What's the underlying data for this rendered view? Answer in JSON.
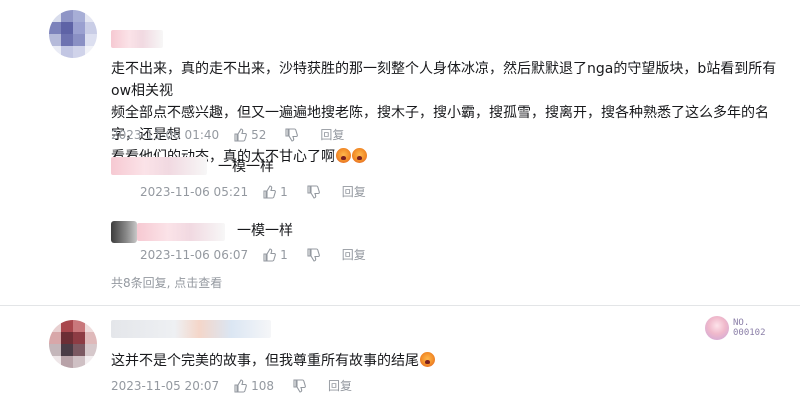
{
  "comments": [
    {
      "text_parts": [
        "走不出来，真的走不出来，沙特获胜的那一刻整个人身体冰凉，然后默默退了nga的守望版块，b站看到所有ow相关视",
        "频全部点不感兴趣，但又一遍遍地搜老陈，搜木子，搜小霸，搜孤雪，搜离开，搜各种熟悉了这么多年的名字，还是想",
        "看看他们的动态，真的太不甘心了啊"
      ],
      "time": "2023-11-06 01:40",
      "likes": "52",
      "reply_label": "回复",
      "replies": [
        {
          "text": "一模一样",
          "time": "2023-11-06 05:21",
          "likes": "1",
          "reply_label": "回复"
        },
        {
          "text": "一模一样",
          "time": "2023-11-06 06:07",
          "likes": "1",
          "reply_label": "回复"
        }
      ],
      "summary": "共8条回复, 点击查看"
    },
    {
      "badge": "NO.\n000102",
      "text": "这并不是个完美的故事，但我尊重所有故事的结尾",
      "time": "2023-11-05 20:07",
      "likes": "108",
      "reply_label": "回复"
    }
  ]
}
